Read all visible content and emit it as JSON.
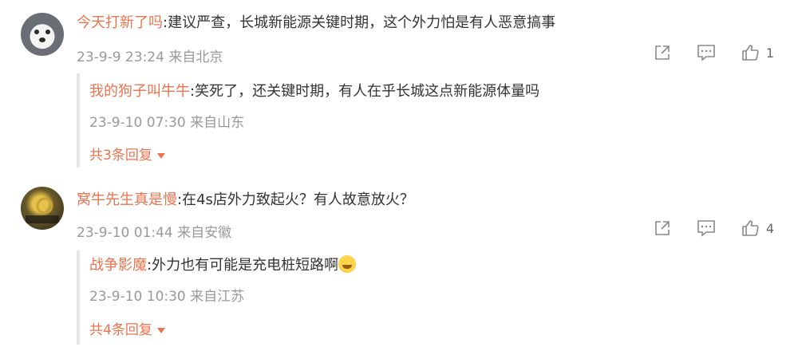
{
  "comments": [
    {
      "user": "今天打新了吗",
      "text": "建议严查，长城新能源关键时期，这个外力怕是有人恶意搞事",
      "meta": "23-9-9 23:24 来自北京",
      "likes": "1",
      "reply": {
        "user": "我的狗子叫牛牛",
        "text": "笑死了，还关键时期，有人在乎长城这点新能源体量吗",
        "meta": "23-9-10 07:30 来自山东",
        "more": "共3条回复"
      }
    },
    {
      "user": "窝牛先生真是慢",
      "text": "在4s店外力致起火？有人故意放火？",
      "meta": "23-9-10 01:44 来自安徽",
      "likes": "4",
      "reply": {
        "user": "战争影魔",
        "text": "外力也有可能是充电桩短路啊",
        "meta": "23-9-10 10:30 来自江苏",
        "more": "共4条回复"
      }
    }
  ],
  "separator": ":",
  "icons": [
    "share-icon",
    "comment-icon",
    "like-icon",
    "caret-down-icon",
    "laughing-emoji-icon"
  ],
  "colors": {
    "username": "#eb7350",
    "meta": "#999999",
    "text": "#333333"
  }
}
